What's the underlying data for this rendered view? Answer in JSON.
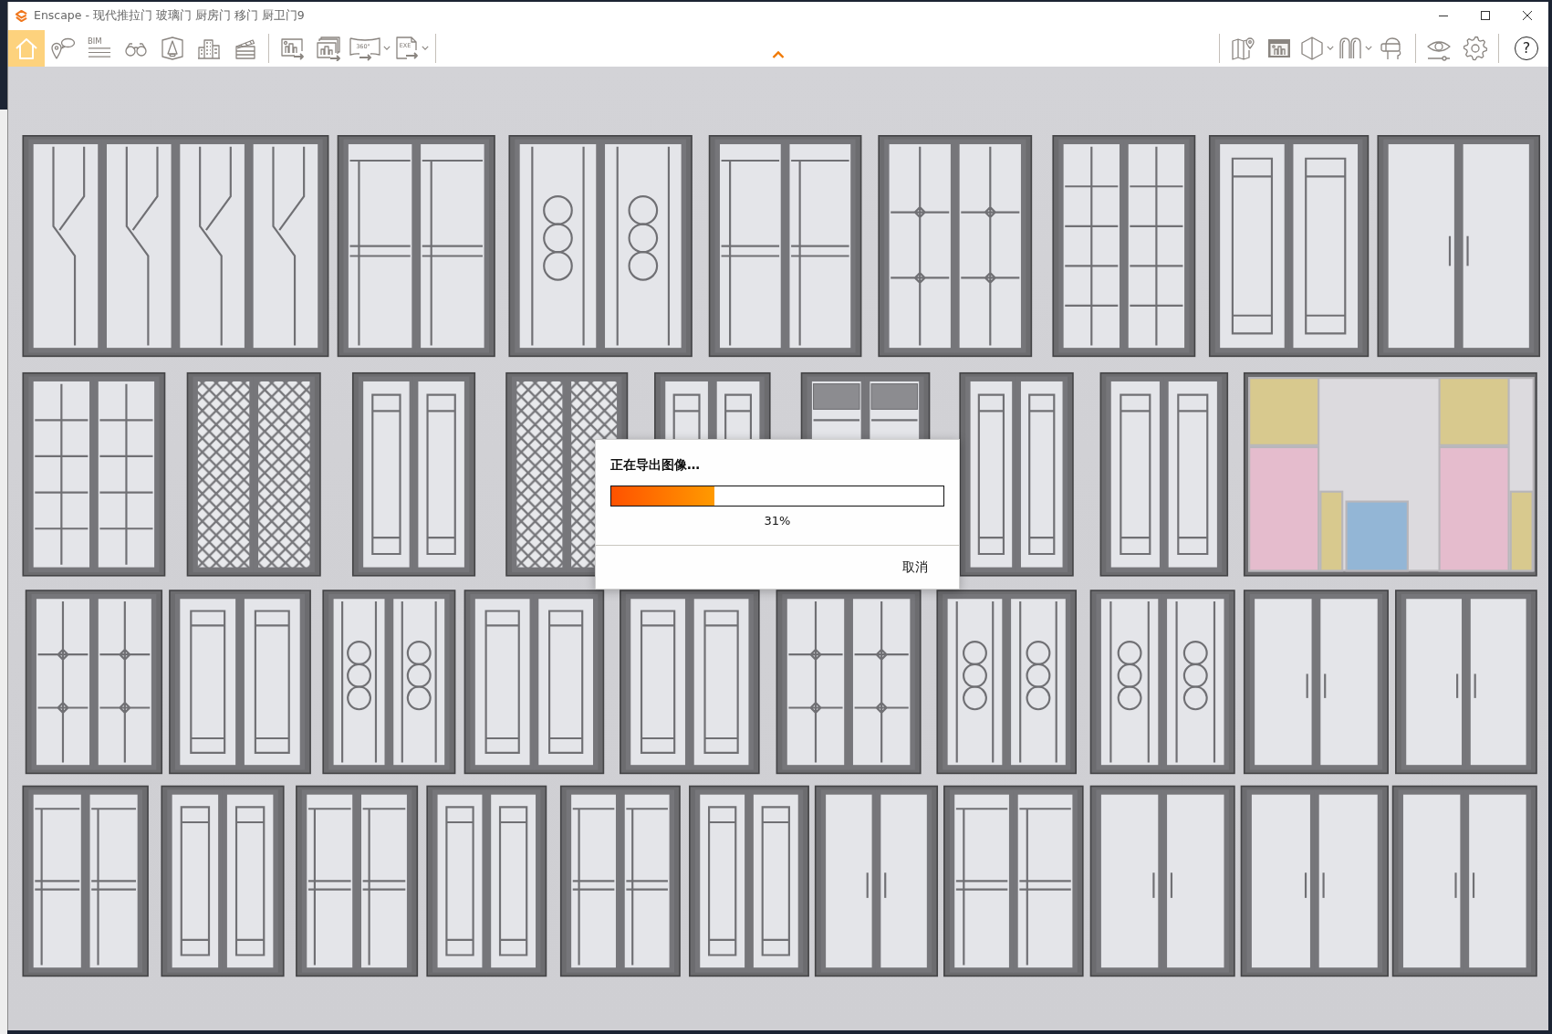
{
  "window": {
    "title": "Enscape - 现代推拉门 玻璃门 厨房门 移门 厨卫门9"
  },
  "toolbar": {
    "left": [
      [
        {
          "kind": "home",
          "selected": true,
          "dropdown": false
        },
        {
          "kind": "views",
          "selected": false,
          "dropdown": false
        },
        {
          "kind": "bim",
          "label": "BIM",
          "selected": false,
          "dropdown": false
        },
        {
          "kind": "binoculars",
          "selected": false,
          "dropdown": false
        },
        {
          "kind": "perspective",
          "selected": false,
          "dropdown": false
        },
        {
          "kind": "buildings",
          "selected": false,
          "dropdown": false
        },
        {
          "kind": "clapper",
          "selected": false,
          "dropdown": false
        }
      ],
      [
        {
          "kind": "screenshot",
          "selected": false,
          "dropdown": false
        },
        {
          "kind": "batch",
          "selected": false,
          "dropdown": false
        },
        {
          "kind": "panorama",
          "label": "360°",
          "selected": false,
          "dropdown": true
        },
        {
          "kind": "exe",
          "label": "EXE",
          "selected": false,
          "dropdown": true
        }
      ]
    ],
    "right": [
      [
        {
          "kind": "map",
          "selected": false,
          "dropdown": false
        },
        {
          "kind": "viewer",
          "selected": false,
          "dropdown": false
        },
        {
          "kind": "compare",
          "selected": false,
          "dropdown": true
        },
        {
          "kind": "assets",
          "selected": false,
          "dropdown": true
        },
        {
          "kind": "vr",
          "selected": false,
          "dropdown": false
        }
      ],
      [
        {
          "kind": "eye",
          "selected": false,
          "dropdown": false
        },
        {
          "kind": "settings",
          "selected": false,
          "dropdown": false
        }
      ],
      [
        {
          "kind": "help",
          "label": "?",
          "selected": false,
          "dropdown": false
        }
      ]
    ]
  },
  "dialog": {
    "message": "正在导出图像…",
    "progress": {
      "level": 0.31,
      "reading": "31%"
    },
    "buttons": [
      "取消"
    ]
  }
}
